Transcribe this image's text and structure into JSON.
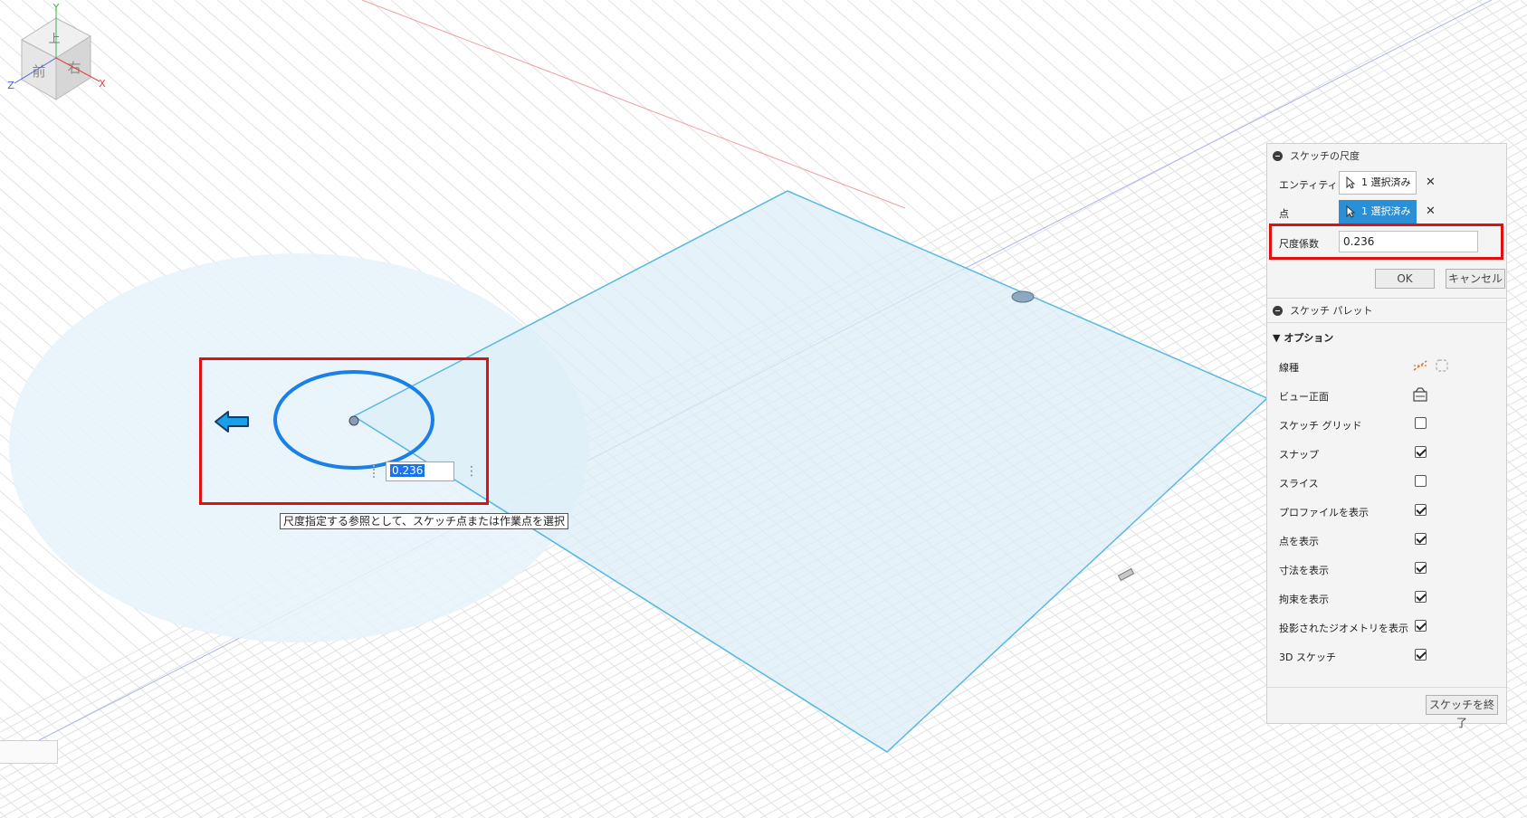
{
  "canvas": {
    "dimension_value": "0.236",
    "tooltip": "尺度指定する参照として、スケッチ点または作業点を選択",
    "viewcube": {
      "faces": [
        "上",
        "前",
        "右"
      ],
      "axes": [
        "Y",
        "Z",
        "X"
      ],
      "axis_colors": {
        "x": "#e04040",
        "y": "#40b040",
        "z": "#4a60d8"
      }
    }
  },
  "panel": {
    "scale_section": {
      "title": "スケッチの尺度",
      "entity_label": "エンティティ",
      "entity_value": "1 選択済み",
      "point_label": "点",
      "point_value": "1 選択済み",
      "factor_label": "尺度係数",
      "factor_value": "0.236",
      "ok_label": "OK",
      "cancel_label": "キャンセル"
    },
    "palette_section": {
      "title": "スケッチ パレット",
      "options_label": "オプション",
      "options": [
        {
          "label": "線種",
          "control": "icons"
        },
        {
          "label": "ビュー正面",
          "control": "icon"
        },
        {
          "label": "スケッチ グリッド",
          "checked": false
        },
        {
          "label": "スナップ",
          "checked": true
        },
        {
          "label": "スライス",
          "checked": false
        },
        {
          "label": "プロファイルを表示",
          "checked": true
        },
        {
          "label": "点を表示",
          "checked": true
        },
        {
          "label": "寸法を表示",
          "checked": true
        },
        {
          "label": "拘束を表示",
          "checked": true
        },
        {
          "label": "投影されたジオメトリを表示",
          "checked": true
        },
        {
          "label": "3D スケッチ",
          "checked": true
        }
      ],
      "finish_label": "スケッチを終了"
    }
  },
  "colors": {
    "accent": "#2b8fd6",
    "highlight": "#e01010",
    "sketch_line": "#1a80e8",
    "plane_fill": "#e3f1f9",
    "plane_edge": "#5ab8e0",
    "grid": "#e2e2e2"
  }
}
